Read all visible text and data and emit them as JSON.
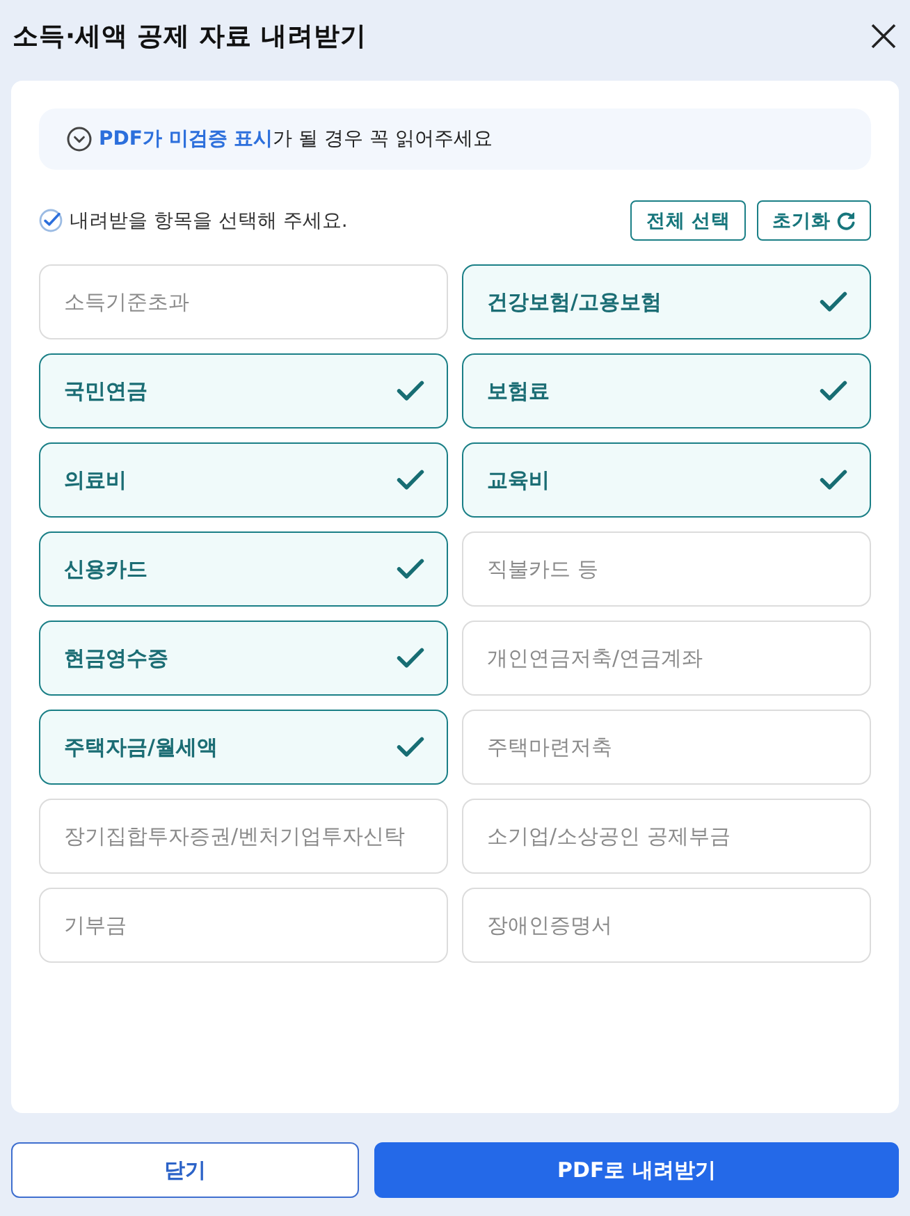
{
  "dialog": {
    "title": "소득·세액 공제 자료 내려받기"
  },
  "notice": {
    "text": "**PDF가 미검증 표시**가 될 경우 꼭 읽어주세요"
  },
  "instruction": "내려받을 항목을 선택해 주세요.",
  "actions": [
    {
      "label": "전체 선택",
      "kind": "select-all"
    },
    {
      "label": "초기화",
      "kind": "reset"
    }
  ],
  "items": [
    {
      "label": "소득기준초과",
      "selected": false
    },
    {
      "label": "건강보험/고용보험",
      "selected": true
    },
    {
      "label": "국민연금",
      "selected": true
    },
    {
      "label": "보험료",
      "selected": true
    },
    {
      "label": "의료비",
      "selected": true
    },
    {
      "label": "교육비",
      "selected": true
    },
    {
      "label": "신용카드",
      "selected": true
    },
    {
      "label": "직불카드 등",
      "selected": false
    },
    {
      "label": "현금영수증",
      "selected": true
    },
    {
      "label": "개인연금저축/연금계좌",
      "selected": false
    },
    {
      "label": "주택자금/월세액",
      "selected": true
    },
    {
      "label": "주택마련저축",
      "selected": false
    },
    {
      "label": "장기집합투자증권/벤처기업투자신탁",
      "selected": false
    },
    {
      "label": "소기업/소상공인 공제부금",
      "selected": false
    },
    {
      "label": "기부금",
      "selected": false
    },
    {
      "label": "장애인증명서",
      "selected": false
    }
  ],
  "footer": {
    "buttons": [
      {
        "label": "닫기",
        "kind": "secondary"
      },
      {
        "label": "PDF로 내려받기",
        "kind": "primary"
      }
    ]
  }
}
